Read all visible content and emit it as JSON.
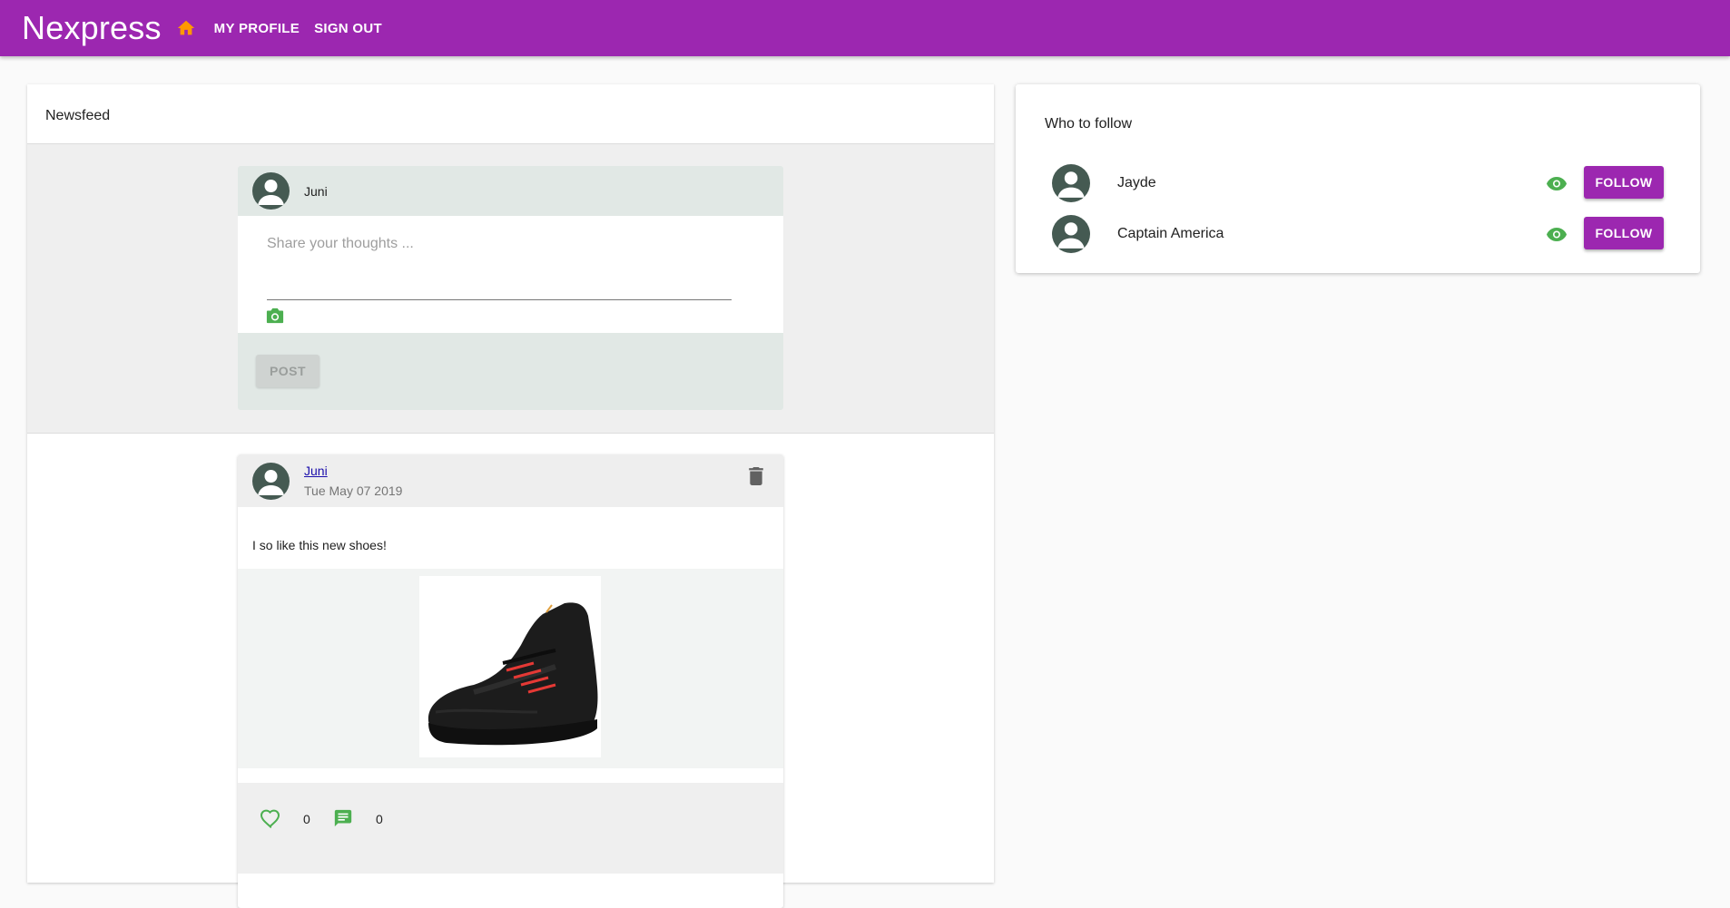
{
  "app": {
    "title": "Nexpress"
  },
  "nav": {
    "home_icon": "home-icon",
    "my_profile": "MY PROFILE",
    "sign_out": "SIGN OUT"
  },
  "colors": {
    "primary": "#9c27b0",
    "home_icon": "#ff9800",
    "accent_green": "#4caf50",
    "avatar": "#455a52"
  },
  "newsfeed": {
    "title": "Newsfeed",
    "new_post": {
      "user_name": "Juni",
      "placeholder": "Share your thoughts ...",
      "post_label": "POST"
    },
    "posts": [
      {
        "author": "Juni",
        "date": "Tue May 07 2019",
        "text": "I so like this new shoes!",
        "image": "black sneaker",
        "likes": "0",
        "comments": "0"
      }
    ]
  },
  "who_to_follow": {
    "title": "Who to follow",
    "users": [
      {
        "name": "Jayde",
        "follow_label": "FOLLOW"
      },
      {
        "name": "Captain America",
        "follow_label": "FOLLOW"
      }
    ]
  }
}
